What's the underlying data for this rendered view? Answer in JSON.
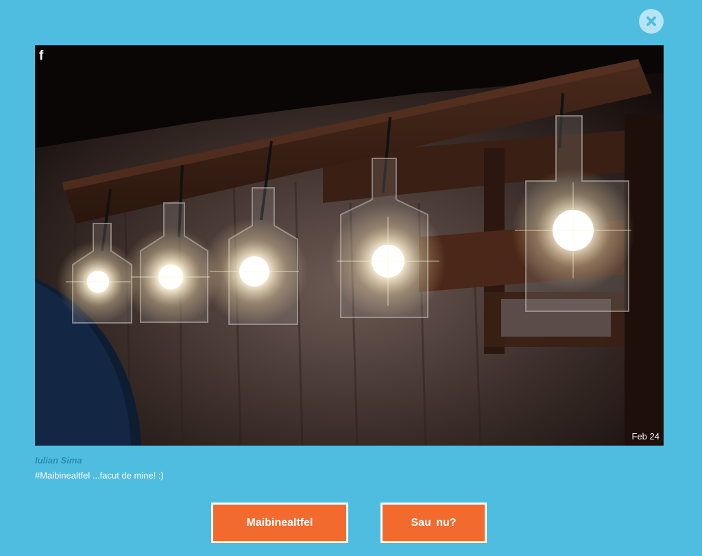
{
  "modal": {
    "close_icon": "close-icon"
  },
  "photo": {
    "source_icon": "facebook-icon",
    "source_glyph": "f",
    "date": "Feb 24",
    "description_icons": [
      "facebook-icon",
      "close-icon"
    ]
  },
  "post": {
    "author": "Iulian Sima",
    "caption": "#Maibinealtfel ...facut de mine! :)"
  },
  "vote": {
    "yes_label": "Maibinealtfel",
    "no_label": "Sau nu?"
  },
  "colors": {
    "background": "#4fbde0",
    "button": "#f26a2e",
    "author": "#2c8bb0",
    "close_circle": "#b7e4f3"
  }
}
